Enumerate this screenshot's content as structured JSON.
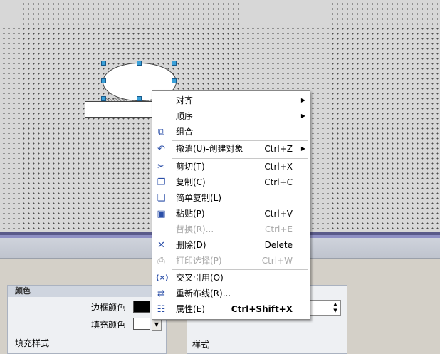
{
  "colors": {
    "canvas": "#d7d7d7",
    "menu_bg": "#ffffff",
    "icon_blue": "#2b4fa8",
    "handle": "#3aa0d8",
    "border_color_swatch": "#000000",
    "fill_color_swatch": "#ffffff"
  },
  "menu": {
    "items": [
      {
        "label": "对齐",
        "shortcut": "",
        "submenu": true,
        "disabled": false,
        "icon": ""
      },
      {
        "label": "顺序",
        "shortcut": "",
        "submenu": true,
        "disabled": false,
        "icon": ""
      },
      {
        "label": "组合",
        "shortcut": "",
        "submenu": false,
        "disabled": false,
        "icon": "group-icon"
      },
      {
        "label": "撤消(U)-创建对象",
        "shortcut": "Ctrl+Z",
        "submenu": true,
        "disabled": false,
        "icon": "undo-icon"
      },
      {
        "label": "剪切(T)",
        "shortcut": "Ctrl+X",
        "submenu": false,
        "disabled": false,
        "icon": "scissors-icon"
      },
      {
        "label": "复制(C)",
        "shortcut": "Ctrl+C",
        "submenu": false,
        "disabled": false,
        "icon": "copy-icon"
      },
      {
        "label": "简单复制(L)",
        "shortcut": "",
        "submenu": false,
        "disabled": false,
        "icon": "simple-copy-icon"
      },
      {
        "label": "粘贴(P)",
        "shortcut": "Ctrl+V",
        "submenu": false,
        "disabled": false,
        "icon": "paste-icon"
      },
      {
        "label": "替换(R)...",
        "shortcut": "Ctrl+E",
        "submenu": false,
        "disabled": true,
        "icon": ""
      },
      {
        "label": "删除(D)",
        "shortcut": "Delete",
        "submenu": false,
        "disabled": false,
        "icon": "delete-icon"
      },
      {
        "label": "打印选择(P)",
        "shortcut": "Ctrl+W",
        "submenu": false,
        "disabled": true,
        "icon": "print-icon"
      },
      {
        "label": "交叉引用(O)",
        "shortcut": "",
        "submenu": false,
        "disabled": false,
        "icon": "cross-reference-icon"
      },
      {
        "label": "重新布线(R)...",
        "shortcut": "",
        "submenu": false,
        "disabled": false,
        "icon": "rewire-icon"
      },
      {
        "label": "属性(E)",
        "shortcut": "Ctrl+Shift+X",
        "submenu": false,
        "disabled": false,
        "icon": "properties-icon"
      }
    ]
  },
  "properties": {
    "color_section_title": "颜色",
    "border_color_label": "边框颜色",
    "fill_color_label": "填充颜色",
    "fill_style_label": "填充样式",
    "style_label": "样式"
  }
}
